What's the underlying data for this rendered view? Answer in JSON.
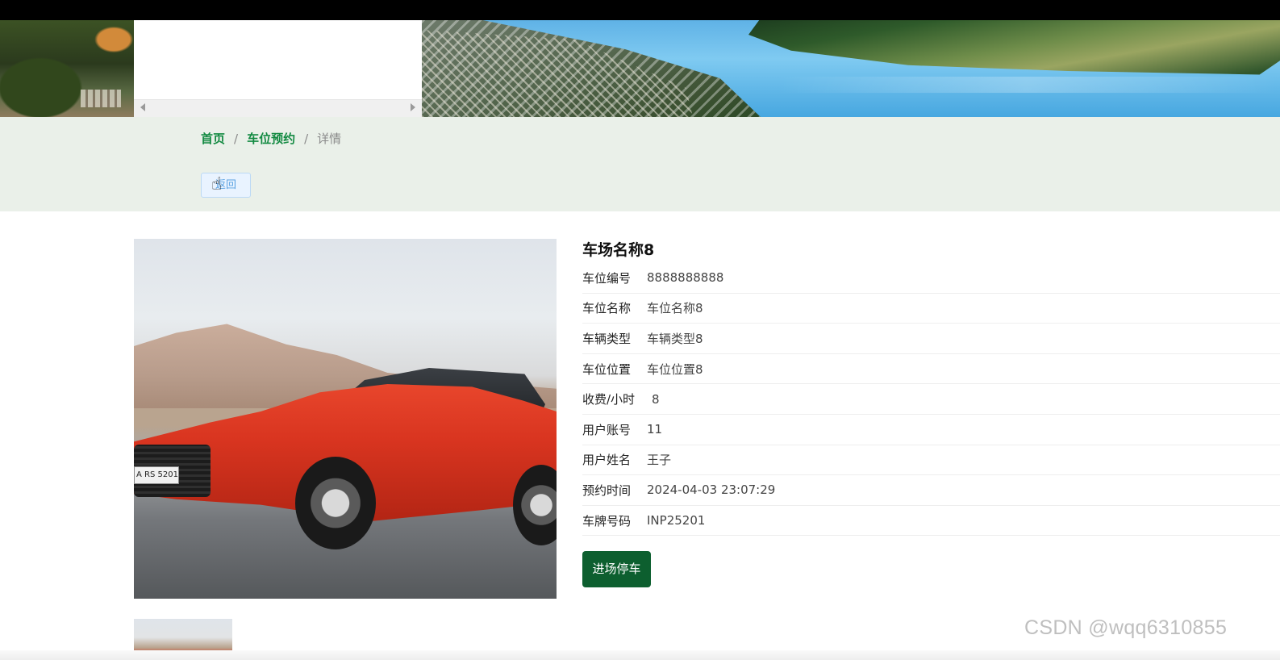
{
  "breadcrumb": {
    "home": "首页",
    "reservation": "车位预约",
    "current": "详情",
    "separator": "/"
  },
  "back_button": "返回",
  "detail": {
    "title": "车场名称8",
    "fields": [
      {
        "label": "车位编号",
        "value": "8888888888"
      },
      {
        "label": "车位名称",
        "value": "车位名称8"
      },
      {
        "label": "车辆类型",
        "value": "车辆类型8"
      },
      {
        "label": "车位位置",
        "value": "车位位置8"
      },
      {
        "label": "收费/小时",
        "value": "8"
      },
      {
        "label": "用户账号",
        "value": "11"
      },
      {
        "label": "用户姓名",
        "value": "王子"
      },
      {
        "label": "预约时间",
        "value": "2024-04-03 23:07:29"
      },
      {
        "label": "车牌号码",
        "value": "INP25201"
      }
    ]
  },
  "enter_button": "进场停车",
  "car_plate_text": "A RS 5201",
  "watermark": "CSDN @wqq6310855",
  "colors": {
    "accent_green": "#138a42",
    "button_green": "#0d5f2f",
    "crumb_band": "#eaf0e9"
  },
  "icons": {
    "cursor": "hand-pointer"
  }
}
